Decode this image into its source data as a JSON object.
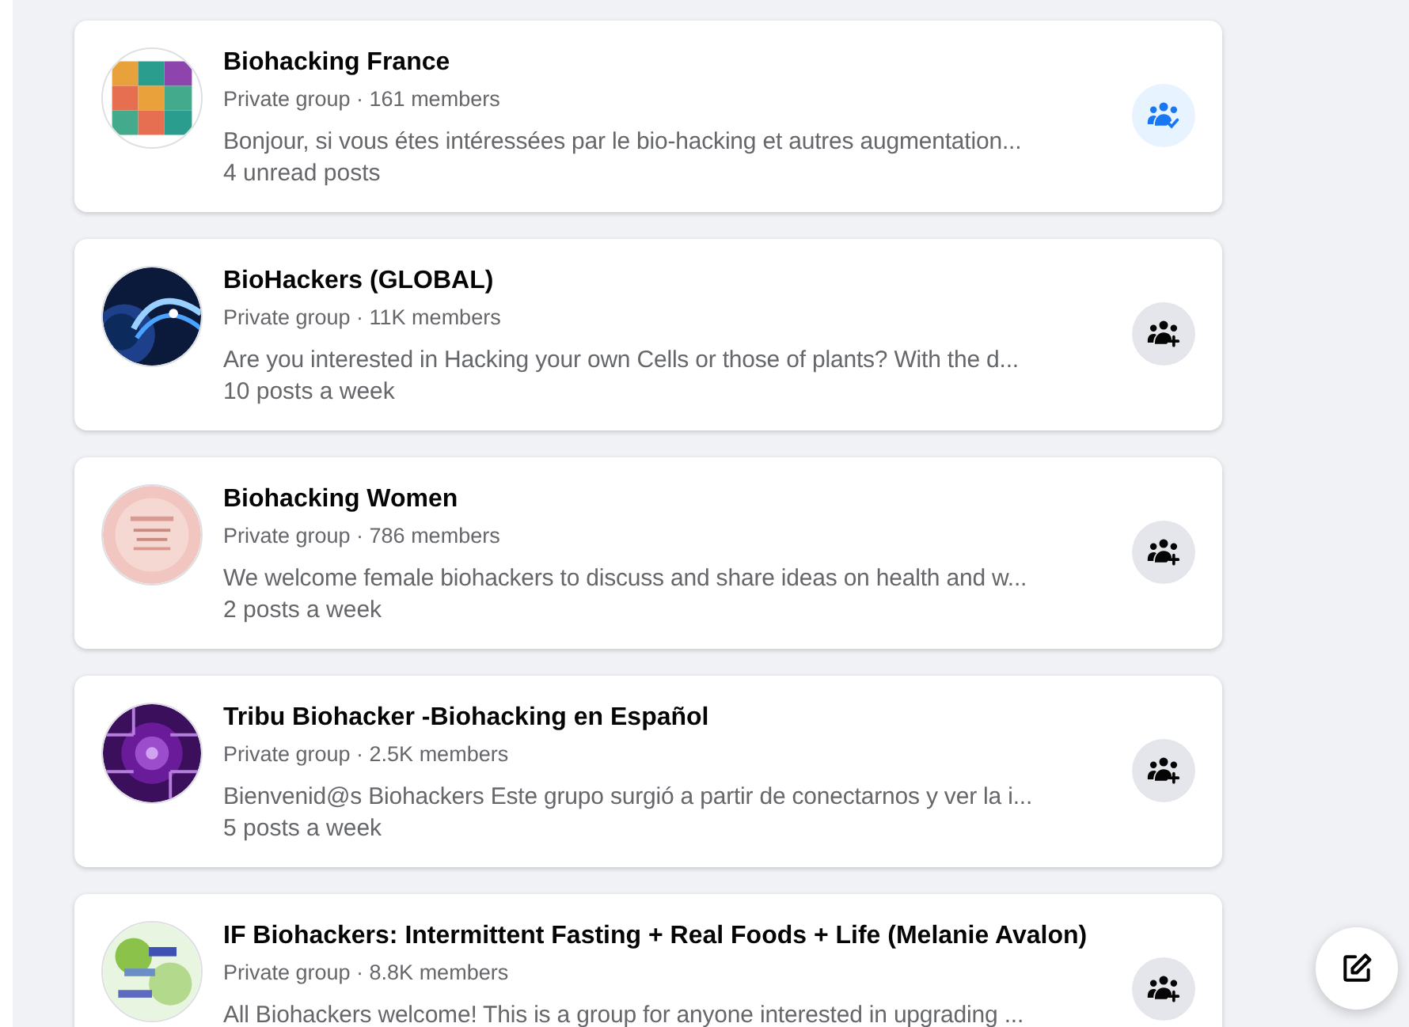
{
  "groups": [
    {
      "name": "Biohacking France",
      "meta": "Private group · 161 members",
      "description": "Bonjour, si vous étes intéressées par le bio-hacking et autres augmentation...",
      "activity": "4 unread posts",
      "joined": true
    },
    {
      "name": "BioHackers (GLOBAL)",
      "meta": "Private group · 11K members",
      "description": "Are you interested in Hacking your own Cells or those of plants? With the d...",
      "activity": "10 posts a week",
      "joined": false
    },
    {
      "name": "Biohacking Women",
      "meta": "Private group · 786 members",
      "description": "We welcome female biohackers to discuss and share ideas on health and w...",
      "activity": "2 posts a week",
      "joined": false
    },
    {
      "name": "Tribu Biohacker -Biohacking en Español",
      "meta": "Private group · 2.5K members",
      "description": "Bienvenid@s Biohackers Este grupo surgió a partir de conectarnos y ver la i...",
      "activity": "5 posts a week",
      "joined": false
    },
    {
      "name": "IF Biohackers: Intermittent Fasting + Real Foods + Life (Melanie Avalon)",
      "meta": "Private group · 8.8K members",
      "description": "All Biohackers welcome! This is a group for anyone interested in upgrading ...",
      "joined": false
    }
  ]
}
